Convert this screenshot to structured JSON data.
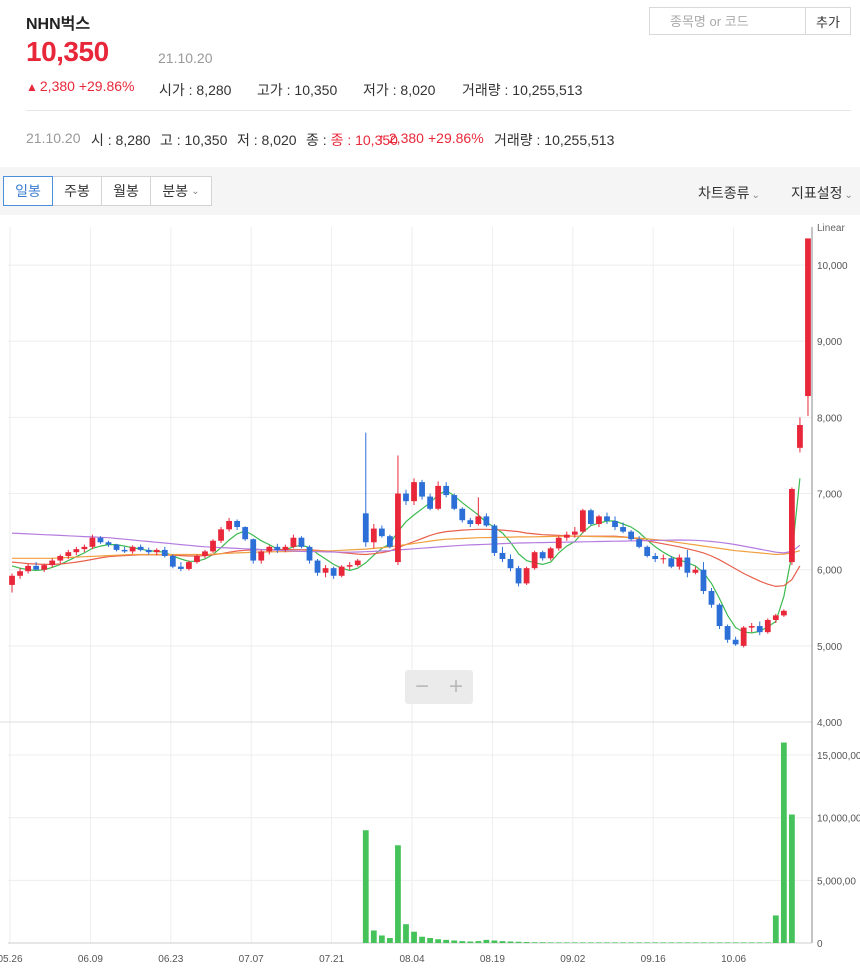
{
  "header": {
    "name": "NHN벅스",
    "price": "10,350",
    "date": "21.10.20",
    "change_arrow": "▲",
    "change": "2,380",
    "change_pct": "+29.86%",
    "open_label": "시가 : 8,280",
    "high_label": "고가 : 10,350",
    "low_label": "저가 : 8,020",
    "volume_label": "거래량 : 10,255,513"
  },
  "search": {
    "placeholder": "종목명 or 코드",
    "button": "추가"
  },
  "detail": {
    "date": "21.10.20",
    "open": "시 : 8,280",
    "high": "고 : 10,350",
    "low": "저 : 8,020",
    "close": "종 : 10,350",
    "change": "↑ 2,380",
    "change_pct": "+29.86%",
    "volume": "거래량 : 10,255,513"
  },
  "toolbar": {
    "tabs": [
      "일봉",
      "주봉",
      "월봉",
      "분봉"
    ],
    "chart_type": "차트종류",
    "indicator": "지표설정"
  },
  "zoom": {
    "minus": "−",
    "plus": "+"
  },
  "colors": {
    "up": "#e8283a",
    "down": "#2c6fd6",
    "volume": "#45c35a",
    "ma5": "#3cba50",
    "ma20": "#e8604c",
    "ma60": "#f0a040",
    "ma120": "#b57ce0"
  },
  "chart_data": {
    "type": "candlestick",
    "scale_label": "Linear",
    "price_axis": {
      "min": 4000,
      "max": 10500,
      "ticks": [
        4000,
        5000,
        6000,
        7000,
        8000,
        9000,
        10000
      ],
      "tick_labels": [
        "4,000",
        "5,000",
        "6,000",
        "7,000",
        "8,000",
        "9,000",
        "10,000"
      ]
    },
    "volume_axis": {
      "min": 0,
      "max": 17000000,
      "ticks": [
        0,
        5000000,
        10000000,
        15000000
      ],
      "tick_labels": [
        "0",
        "5,000,00",
        "10,000,00",
        "15,000,00"
      ]
    },
    "x_tick_labels": [
      {
        "index": 0,
        "label": "05.26"
      },
      {
        "index": 10,
        "label": "06.09"
      },
      {
        "index": 20,
        "label": "06.23"
      },
      {
        "index": 30,
        "label": "07.07"
      },
      {
        "index": 40,
        "label": "07.21"
      },
      {
        "index": 50,
        "label": "08.04"
      },
      {
        "index": 60,
        "label": "08.19"
      },
      {
        "index": 70,
        "label": "09.02"
      },
      {
        "index": 80,
        "label": "09.16"
      },
      {
        "index": 90,
        "label": "10.06"
      }
    ],
    "ohlc": [
      [
        5800,
        5950,
        5700,
        5920
      ],
      [
        5920,
        6020,
        5880,
        5980
      ],
      [
        5980,
        6080,
        5950,
        6050
      ],
      [
        6050,
        6100,
        6000,
        6000
      ],
      [
        6000,
        6080,
        5970,
        6060
      ],
      [
        6060,
        6150,
        6030,
        6120
      ],
      [
        6120,
        6200,
        6080,
        6180
      ],
      [
        6180,
        6260,
        6140,
        6230
      ],
      [
        6230,
        6300,
        6190,
        6270
      ],
      [
        6270,
        6330,
        6230,
        6300
      ],
      [
        6300,
        6460,
        6270,
        6420
      ],
      [
        6420,
        6440,
        6340,
        6360
      ],
      [
        6360,
        6380,
        6300,
        6330
      ],
      [
        6330,
        6340,
        6240,
        6260
      ],
      [
        6260,
        6300,
        6220,
        6240
      ],
      [
        6240,
        6320,
        6210,
        6300
      ],
      [
        6300,
        6330,
        6240,
        6260
      ],
      [
        6260,
        6290,
        6200,
        6230
      ],
      [
        6230,
        6280,
        6190,
        6260
      ],
      [
        6260,
        6300,
        6160,
        6180
      ],
      [
        6180,
        6200,
        6020,
        6040
      ],
      [
        6040,
        6100,
        5980,
        6010
      ],
      [
        6010,
        6120,
        5990,
        6100
      ],
      [
        6100,
        6200,
        6080,
        6180
      ],
      [
        6180,
        6260,
        6150,
        6240
      ],
      [
        6240,
        6400,
        6220,
        6380
      ],
      [
        6380,
        6560,
        6350,
        6530
      ],
      [
        6530,
        6680,
        6500,
        6640
      ],
      [
        6640,
        6660,
        6520,
        6560
      ],
      [
        6560,
        6570,
        6380,
        6400
      ],
      [
        6400,
        6410,
        6080,
        6120
      ],
      [
        6120,
        6260,
        6080,
        6240
      ],
      [
        6240,
        6320,
        6200,
        6300
      ],
      [
        6300,
        6340,
        6220,
        6260
      ],
      [
        6260,
        6330,
        6230,
        6300
      ],
      [
        6300,
        6460,
        6280,
        6420
      ],
      [
        6420,
        6440,
        6280,
        6300
      ],
      [
        6300,
        6320,
        6080,
        6120
      ],
      [
        6120,
        6140,
        5920,
        5960
      ],
      [
        5960,
        6060,
        5900,
        6020
      ],
      [
        6020,
        6040,
        5880,
        5920
      ],
      [
        5920,
        6060,
        5900,
        6040
      ],
      [
        6040,
        6100,
        6000,
        6060
      ],
      [
        6060,
        6140,
        6040,
        6120
      ],
      [
        6740,
        7800,
        6300,
        6360
      ],
      [
        6360,
        6600,
        6280,
        6540
      ],
      [
        6540,
        6580,
        6420,
        6440
      ],
      [
        6440,
        6460,
        6280,
        6300
      ],
      [
        6100,
        7500,
        6060,
        7000
      ],
      [
        7000,
        7050,
        6850,
        6900
      ],
      [
        6900,
        7200,
        6850,
        7150
      ],
      [
        7150,
        7180,
        6920,
        6960
      ],
      [
        6960,
        7000,
        6780,
        6800
      ],
      [
        6800,
        7160,
        6780,
        7100
      ],
      [
        7100,
        7150,
        6950,
        6980
      ],
      [
        6980,
        7000,
        6780,
        6800
      ],
      [
        6800,
        6820,
        6620,
        6650
      ],
      [
        6650,
        6680,
        6560,
        6600
      ],
      [
        6600,
        6950,
        6580,
        6700
      ],
      [
        6700,
        6740,
        6560,
        6580
      ],
      [
        6580,
        6600,
        6180,
        6220
      ],
      [
        6220,
        6300,
        6100,
        6140
      ],
      [
        6140,
        6200,
        5980,
        6020
      ],
      [
        6020,
        6050,
        5780,
        5820
      ],
      [
        5820,
        6040,
        5800,
        6020
      ],
      [
        6020,
        6250,
        6000,
        6230
      ],
      [
        6230,
        6250,
        6120,
        6150
      ],
      [
        6150,
        6300,
        6120,
        6280
      ],
      [
        6280,
        6440,
        6250,
        6420
      ],
      [
        6420,
        6500,
        6380,
        6460
      ],
      [
        6460,
        6560,
        6420,
        6500
      ],
      [
        6500,
        6800,
        6480,
        6780
      ],
      [
        6780,
        6800,
        6580,
        6600
      ],
      [
        6600,
        6720,
        6560,
        6700
      ],
      [
        6700,
        6750,
        6600,
        6640
      ],
      [
        6640,
        6700,
        6520,
        6560
      ],
      [
        6560,
        6620,
        6480,
        6500
      ],
      [
        6500,
        6520,
        6380,
        6400
      ],
      [
        6400,
        6440,
        6280,
        6300
      ],
      [
        6300,
        6320,
        6160,
        6180
      ],
      [
        6180,
        6220,
        6100,
        6140
      ],
      [
        6140,
        6200,
        6080,
        6150
      ],
      [
        6150,
        6180,
        6020,
        6040
      ],
      [
        6040,
        6200,
        6000,
        6160
      ],
      [
        6160,
        6260,
        5900,
        5960
      ],
      [
        5960,
        6040,
        5940,
        6000
      ],
      [
        6000,
        6100,
        5680,
        5720
      ],
      [
        5720,
        5760,
        5500,
        5540
      ],
      [
        5540,
        5560,
        5220,
        5260
      ],
      [
        5260,
        5280,
        5040,
        5080
      ],
      [
        5080,
        5120,
        5000,
        5020
      ],
      [
        5000,
        5260,
        4980,
        5240
      ],
      [
        5240,
        5300,
        5180,
        5260
      ],
      [
        5260,
        5320,
        5140,
        5180
      ],
      [
        5180,
        5360,
        5160,
        5340
      ],
      [
        5340,
        5420,
        5300,
        5400
      ],
      [
        5400,
        5480,
        5380,
        5460
      ],
      [
        6100,
        7080,
        6060,
        7060
      ],
      [
        7600,
        8000,
        7540,
        7900
      ],
      [
        8280,
        10350,
        8020,
        10350
      ]
    ],
    "volume": [
      0,
      0,
      0,
      0,
      0,
      0,
      0,
      0,
      0,
      0,
      0,
      0,
      0,
      0,
      0,
      0,
      0,
      0,
      0,
      0,
      0,
      0,
      0,
      0,
      0,
      0,
      0,
      0,
      0,
      0,
      0,
      0,
      0,
      0,
      0,
      0,
      0,
      0,
      0,
      0,
      0,
      0,
      0,
      0,
      9000000,
      1000000,
      600000,
      400000,
      7800000,
      1500000,
      900000,
      500000,
      400000,
      300000,
      250000,
      200000,
      150000,
      120000,
      150000,
      250000,
      200000,
      150000,
      120000,
      100000,
      80000,
      60000,
      60000,
      50000,
      50000,
      50000,
      50000,
      50000,
      50000,
      50000,
      50000,
      50000,
      50000,
      50000,
      50000,
      50000,
      50000,
      50000,
      50000,
      50000,
      50000,
      50000,
      50000,
      50000,
      50000,
      50000,
      50000,
      50000,
      50000,
      50000,
      50000,
      2200000,
      16000000,
      10255513
    ],
    "series": [
      {
        "key": "ma5",
        "values": [
          6050,
          6020,
          6000,
          5990,
          6000,
          6030,
          6070,
          6120,
          6170,
          6220,
          6280,
          6310,
          6330,
          6330,
          6310,
          6290,
          6270,
          6250,
          6240,
          6230,
          6180,
          6140,
          6110,
          6110,
          6140,
          6200,
          6290,
          6390,
          6470,
          6510,
          6450,
          6380,
          6330,
          6270,
          6260,
          6300,
          6320,
          6290,
          6210,
          6140,
          6070,
          6020,
          5990,
          6020,
          6090,
          6190,
          6280,
          6340,
          6500,
          6630,
          6720,
          6800,
          6880,
          6980,
          7040,
          6970,
          6880,
          6800,
          6720,
          6620,
          6560,
          6480,
          6360,
          6210,
          6120,
          6090,
          6070,
          6100,
          6220,
          6310,
          6370,
          6490,
          6580,
          6610,
          6640,
          6640,
          6600,
          6560,
          6490,
          6390,
          6300,
          6230,
          6170,
          6130,
          6090,
          6050,
          5960,
          5820,
          5620,
          5400,
          5240,
          5180,
          5170,
          5190,
          5250,
          5320,
          5650,
          6200,
          7200
        ]
      },
      {
        "key": "ma20",
        "values": [
          6100,
          6090,
          6080,
          6075,
          6070,
          6070,
          6075,
          6085,
          6100,
          6115,
          6135,
          6155,
          6170,
          6180,
          6185,
          6190,
          6195,
          6195,
          6195,
          6195,
          6190,
          6185,
          6180,
          6180,
          6185,
          6195,
          6210,
          6230,
          6245,
          6255,
          6260,
          6262,
          6262,
          6262,
          6262,
          6263,
          6263,
          6260,
          6255,
          6245,
          6235,
          6225,
          6215,
          6205,
          6200,
          6210,
          6225,
          6245,
          6290,
          6330,
          6370,
          6410,
          6450,
          6480,
          6500,
          6510,
          6520,
          6525,
          6530,
          6530,
          6525,
          6520,
          6510,
          6500,
          6480,
          6470,
          6460,
          6455,
          6450,
          6445,
          6440,
          6440,
          6440,
          6440,
          6440,
          6440,
          6430,
          6420,
          6400,
          6380,
          6360,
          6340,
          6320,
          6300,
          6275,
          6250,
          6220,
          6180,
          6130,
          6070,
          6010,
          5950,
          5900,
          5850,
          5810,
          5780,
          5790,
          5870,
          6050
        ]
      },
      {
        "key": "ma60",
        "values": [
          6150,
          6150,
          6150,
          6150,
          6150,
          6150,
          6155,
          6160,
          6165,
          6170,
          6175,
          6180,
          6185,
          6190,
          6195,
          6200,
          6200,
          6200,
          6200,
          6200,
          6200,
          6200,
          6200,
          6200,
          6200,
          6205,
          6210,
          6215,
          6220,
          6225,
          6230,
          6232,
          6234,
          6236,
          6238,
          6240,
          6242,
          6244,
          6246,
          6248,
          6250,
          6255,
          6260,
          6265,
          6270,
          6280,
          6290,
          6300,
          6315,
          6330,
          6345,
          6360,
          6375,
          6390,
          6400,
          6405,
          6410,
          6415,
          6420,
          6422,
          6424,
          6426,
          6428,
          6430,
          6430,
          6432,
          6434,
          6436,
          6438,
          6440,
          6440,
          6438,
          6436,
          6434,
          6432,
          6430,
          6425,
          6420,
          6415,
          6405,
          6395,
          6385,
          6370,
          6355,
          6340,
          6325,
          6310,
          6295,
          6280,
          6265,
          6250,
          6240,
          6230,
          6220,
          6210,
          6200,
          6205,
          6220,
          6250
        ]
      },
      {
        "key": "ma120",
        "values": [
          6480,
          6475,
          6470,
          6465,
          6460,
          6455,
          6450,
          6445,
          6440,
          6435,
          6430,
          6425,
          6420,
          6410,
          6400,
          6390,
          6380,
          6370,
          6360,
          6350,
          6340,
          6330,
          6320,
          6310,
          6300,
          6295,
          6290,
          6285,
          6280,
          6275,
          6270,
          6265,
          6260,
          6255,
          6250,
          6245,
          6240,
          6238,
          6236,
          6234,
          6232,
          6230,
          6230,
          6232,
          6236,
          6240,
          6245,
          6250,
          6258,
          6266,
          6274,
          6282,
          6290,
          6298,
          6306,
          6314,
          6320,
          6326,
          6330,
          6334,
          6338,
          6342,
          6346,
          6350,
          6352,
          6354,
          6356,
          6358,
          6360,
          6362,
          6364,
          6366,
          6368,
          6370,
          6372,
          6374,
          6376,
          6378,
          6380,
          6382,
          6384,
          6386,
          6388,
          6390,
          6388,
          6386,
          6380,
          6370,
          6360,
          6345,
          6330,
          6310,
          6290,
          6270,
          6250,
          6230,
          6220,
          6240,
          6320
        ]
      }
    ]
  }
}
